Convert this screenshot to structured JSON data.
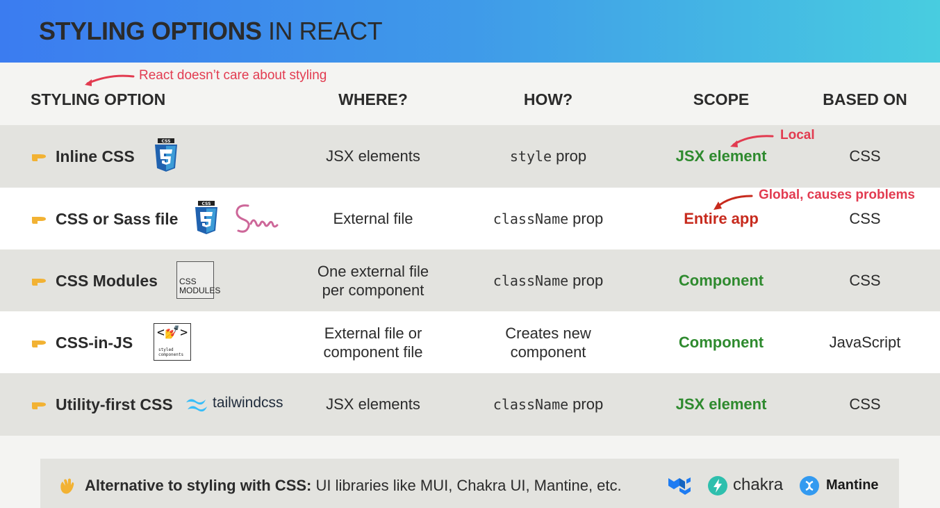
{
  "header": {
    "title_bold": "STYLING OPTIONS",
    "title_light": "IN REACT"
  },
  "note_react": "React doesn’t care about styling",
  "columns": {
    "option": "STYLING OPTION",
    "where": "WHERE?",
    "how": "HOW?",
    "scope": "SCOPE",
    "based": "BASED ON"
  },
  "rows": [
    {
      "label": "Inline CSS",
      "where": "JSX elements",
      "how_code": "style",
      "how_text": "prop",
      "scope": "JSX element",
      "based": "CSS",
      "icon": "css3-icon"
    },
    {
      "label": "CSS or Sass file",
      "where": "External file",
      "how_code": "className",
      "how_text": "prop",
      "scope": "Entire app",
      "based": "CSS",
      "icon": "css3-icon,sass-logo"
    },
    {
      "label": "CSS Modules",
      "where_line1": "One external file",
      "where_line2": "per component",
      "how_code": "className",
      "how_text": "prop",
      "scope": "Component",
      "based": "CSS",
      "icon_text1": "CSS",
      "icon_text2": "MODULES"
    },
    {
      "label": "CSS-in-JS",
      "where_line1": "External file or",
      "where_line2": "component file",
      "how_line1": "Creates new",
      "how_line2": "component",
      "scope": "Component",
      "based": "JavaScript",
      "icon_text1": "styled",
      "icon_text2": "components"
    },
    {
      "label": "Utility-first CSS",
      "where": "JSX elements",
      "how_code": "className",
      "how_text": "prop",
      "scope": "JSX element",
      "based": "CSS",
      "brand": "tailwindcss"
    }
  ],
  "notes": {
    "local": "Local",
    "global": "Global, causes problems"
  },
  "bottom": {
    "lead": "Alternative to styling with CSS:",
    "rest": "UI libraries like MUI, Chakra UI, Mantine, etc.",
    "chakra": "chakra",
    "mantine": "Mantine"
  },
  "colors": {
    "green": "#2e8a2e",
    "red": "#c72a1d",
    "note": "#e23b50"
  }
}
